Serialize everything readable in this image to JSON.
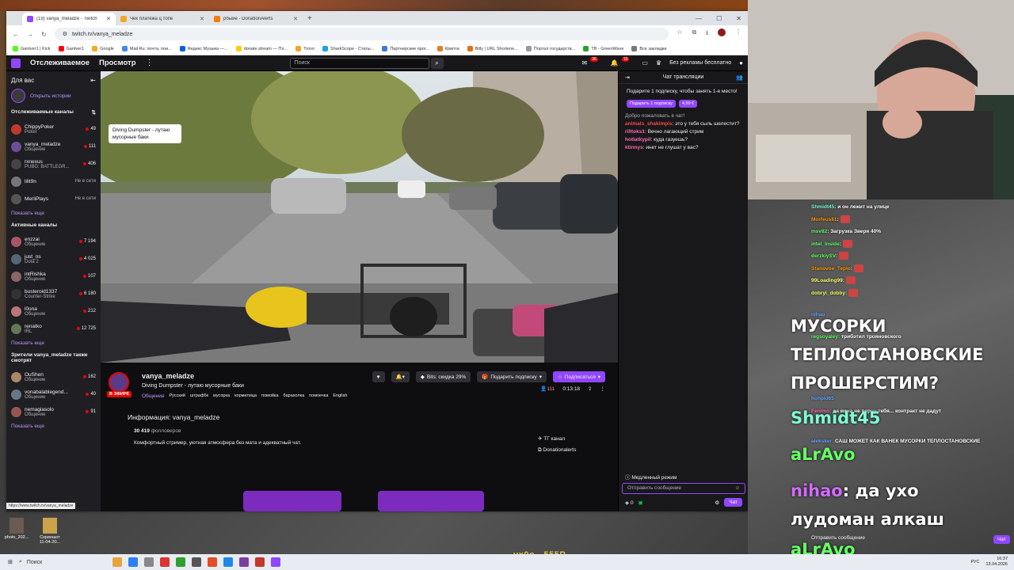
{
  "browser": {
    "tabs": [
      {
        "title": "(19) vanya_meladze - Twitch",
        "active": true
      },
      {
        "title": "Чек платежа ц топе"
      },
      {
        "title": "рбыйе - DonationAlerts"
      }
    ],
    "url": "twitch.tv/vanya_meladze",
    "bookmarks": [
      "Gantver1 | Kick",
      "Gantver1",
      "Google",
      "Mail.Ru: почта, пои...",
      "Яндекс Музыка —...",
      "donate.stream — Пл...",
      "Trovo",
      "SharkScope - Статы...",
      "Партнерские прог...",
      "Крипта",
      "Bitly | URL Shortene...",
      "Портал государств...",
      "TB - GreenWave",
      "Все закладки"
    ]
  },
  "nav": {
    "following": "Отслеживаемое",
    "browse": "Просмотр",
    "search_placeholder": "Поиск",
    "inbox_badge": "36",
    "notif_badge": "19",
    "no_ads": "Без рекламы бесплатно"
  },
  "sidebar": {
    "for_you": "Для вас",
    "open_history": "Открыть истории",
    "followed_title": "Отслеживаемые каналы",
    "followed": [
      {
        "name": "ChippyPoker",
        "game": "Poker",
        "viewers": "49",
        "color": "#c0392b"
      },
      {
        "name": "vanya_meladze",
        "game": "Общение",
        "viewers": "111",
        "color": "#6c4d9a"
      },
      {
        "name": "rxnexus",
        "game": "PUBG: BATTLEGR...",
        "viewers": "406",
        "color": "#444"
      },
      {
        "name": "lilit9n",
        "offline": "Не в сети",
        "color": "#777"
      },
      {
        "name": "MerliPlays",
        "offline": "Не в сети",
        "color": "#555"
      }
    ],
    "show_more_1": "Показать еще",
    "active_title": "Активные каналы",
    "active": [
      {
        "name": "enzzai",
        "game": "Общение",
        "viewers": "7 194",
        "color": "#a56"
      },
      {
        "name": "just_ns",
        "game": "Dota 2",
        "viewers": "4 025",
        "color": "#567"
      },
      {
        "name": "intRishka",
        "game": "Общение",
        "viewers": "107",
        "color": "#866"
      },
      {
        "name": "busteroid1337",
        "game": "Counter-Strike",
        "viewers": "6 180",
        "color": "#333"
      },
      {
        "name": "l0ona",
        "game": "Общение",
        "viewers": "212",
        "color": "#b77"
      },
      {
        "name": "renatko",
        "game": "IRL",
        "viewers": "12 725",
        "color": "#675"
      }
    ],
    "show_more_2": "Показать еще",
    "also_watch_title": "Зрители vanya_meladze также смотрят",
    "also_watch": [
      {
        "name": "OuShen",
        "game": "Общение",
        "viewers": "162",
        "color": "#a86"
      },
      {
        "name": "vonabalablegend...",
        "game": "Общение",
        "viewers": "40",
        "color": "#678"
      },
      {
        "name": "nemagiasolo",
        "game": "Общение",
        "viewers": "91",
        "color": "#955"
      }
    ],
    "show_more_3": "Показать еще"
  },
  "tooltip": "Diving Dumpster - лутаю мусорные баки",
  "stream": {
    "channel": "vanya_meladze",
    "live": "В ЭФИРЕ",
    "title": "Diving Dumpster - лутаю мусорные баки",
    "category": "Общение",
    "tags": [
      "Русский",
      "штрафбк",
      "мусорка",
      "кормилица",
      "помойка",
      "барахолка",
      "помоечка",
      "English"
    ],
    "bits": "Bits: скидка 29%",
    "gift_sub": "Подарить подписку",
    "subscribe": "Подписаться",
    "viewers": "111",
    "uptime": "0:13:18",
    "about": "Информация: vanya_meladze",
    "followers_count": "30 419",
    "followers_label": "фолловеров",
    "description": "Комфортный стример, уютная атмосфера без мата и адекватный чат.",
    "links": [
      "ТГ канал",
      "Donationalerts"
    ]
  },
  "chat": {
    "title": "Чат трансляции",
    "gift_text": "Подарите 1 подписку, чтобы занять 1-е место!",
    "gift_btn": "Подарить 1 подписку",
    "gift_price": "4,99 €",
    "welcome": "Добро пожаловать в чат!",
    "messages": [
      {
        "user": "animals_shakimpis",
        "text": "это у тебя сыль шелестит?",
        "color": "#ff4545"
      },
      {
        "user": "rilltoks1",
        "text": "Вечно лагающий стрим",
        "color": "#ff69b4"
      },
      {
        "user": "hotlatkypil",
        "text": "куда газуешь?",
        "color": "#ff69b4"
      },
      {
        "user": "ktinnys",
        "text": "инет не глушат у вас?",
        "color": "#ff69b4"
      }
    ],
    "slow_mode": "Медленный режим",
    "placeholder": "Отправить сообщение",
    "points": "0",
    "send": "Чат"
  },
  "status_url": "https://www.twitch.tv/vanya_meladze",
  "overlay": {
    "msgs": [
      {
        "user": "Shmidt45",
        "text": "и он лежит на улице",
        "color": "#7fffd4"
      },
      {
        "user": "Morfeus81",
        "text": "",
        "color": "#ff9900"
      },
      {
        "user": "msv82",
        "text": "Загрузка Зверя 40%",
        "color": "#66ff66"
      },
      {
        "user": "intel_inside",
        "text": "",
        "color": "#66ff66"
      },
      {
        "user": "derzkiySV",
        "text": "",
        "color": "#66ff66"
      },
      {
        "user": "Stanovoe_Teplo",
        "text": "",
        "color": "#ff9900"
      },
      {
        "user": "99Loading99",
        "text": "",
        "color": "#ffff66"
      },
      {
        "user": "dobryi_dobby",
        "text": "",
        "color": "#ffff66"
      }
    ],
    "big1": "МУСОРКИ",
    "big2": "ТЕПЛОСТАНОВСКИЕ",
    "big3": "ПРОШЕРСТИМ?",
    "big4_user": "Shmidt45",
    "big5_user": "aLrAvo",
    "big6_user": "nihao",
    "big6_text": ": да ухо",
    "big7": "лудоман алкаш",
    "big8_user": "aLrAvo",
    "mid_lines": [
      {
        "user": "nihao",
        "text": "",
        "color": "#66aaff"
      },
      {
        "user": "regsoyaley",
        "text": "трибэтил трояновского",
        "color": "#66ff66"
      },
      {
        "user": "hohpid65",
        "text": "",
        "color": "#66aaff"
      },
      {
        "user": "Fenimo",
        "text": "да жена не верну тебя... контракт не дадут",
        "color": "#ff69b4"
      },
      {
        "user": "aleksker",
        "text": "САШ МОЖЕТ КАК ВАНЕК МУСОРКИ ТЕПЛОСТАНОВСКИЕ",
        "color": "#66aaff"
      }
    ],
    "input": "Отправить сообщение",
    "chat_btn": "Чат"
  },
  "desktop": {
    "icons": [
      "photo_202...",
      "Скриншот 11-04-20..."
    ],
    "donate_line": "ух0о - 555Р"
  },
  "taskbar": {
    "search": "Поиск",
    "lang": "РУС",
    "time": "16:37",
    "date": "13.04.2026"
  }
}
